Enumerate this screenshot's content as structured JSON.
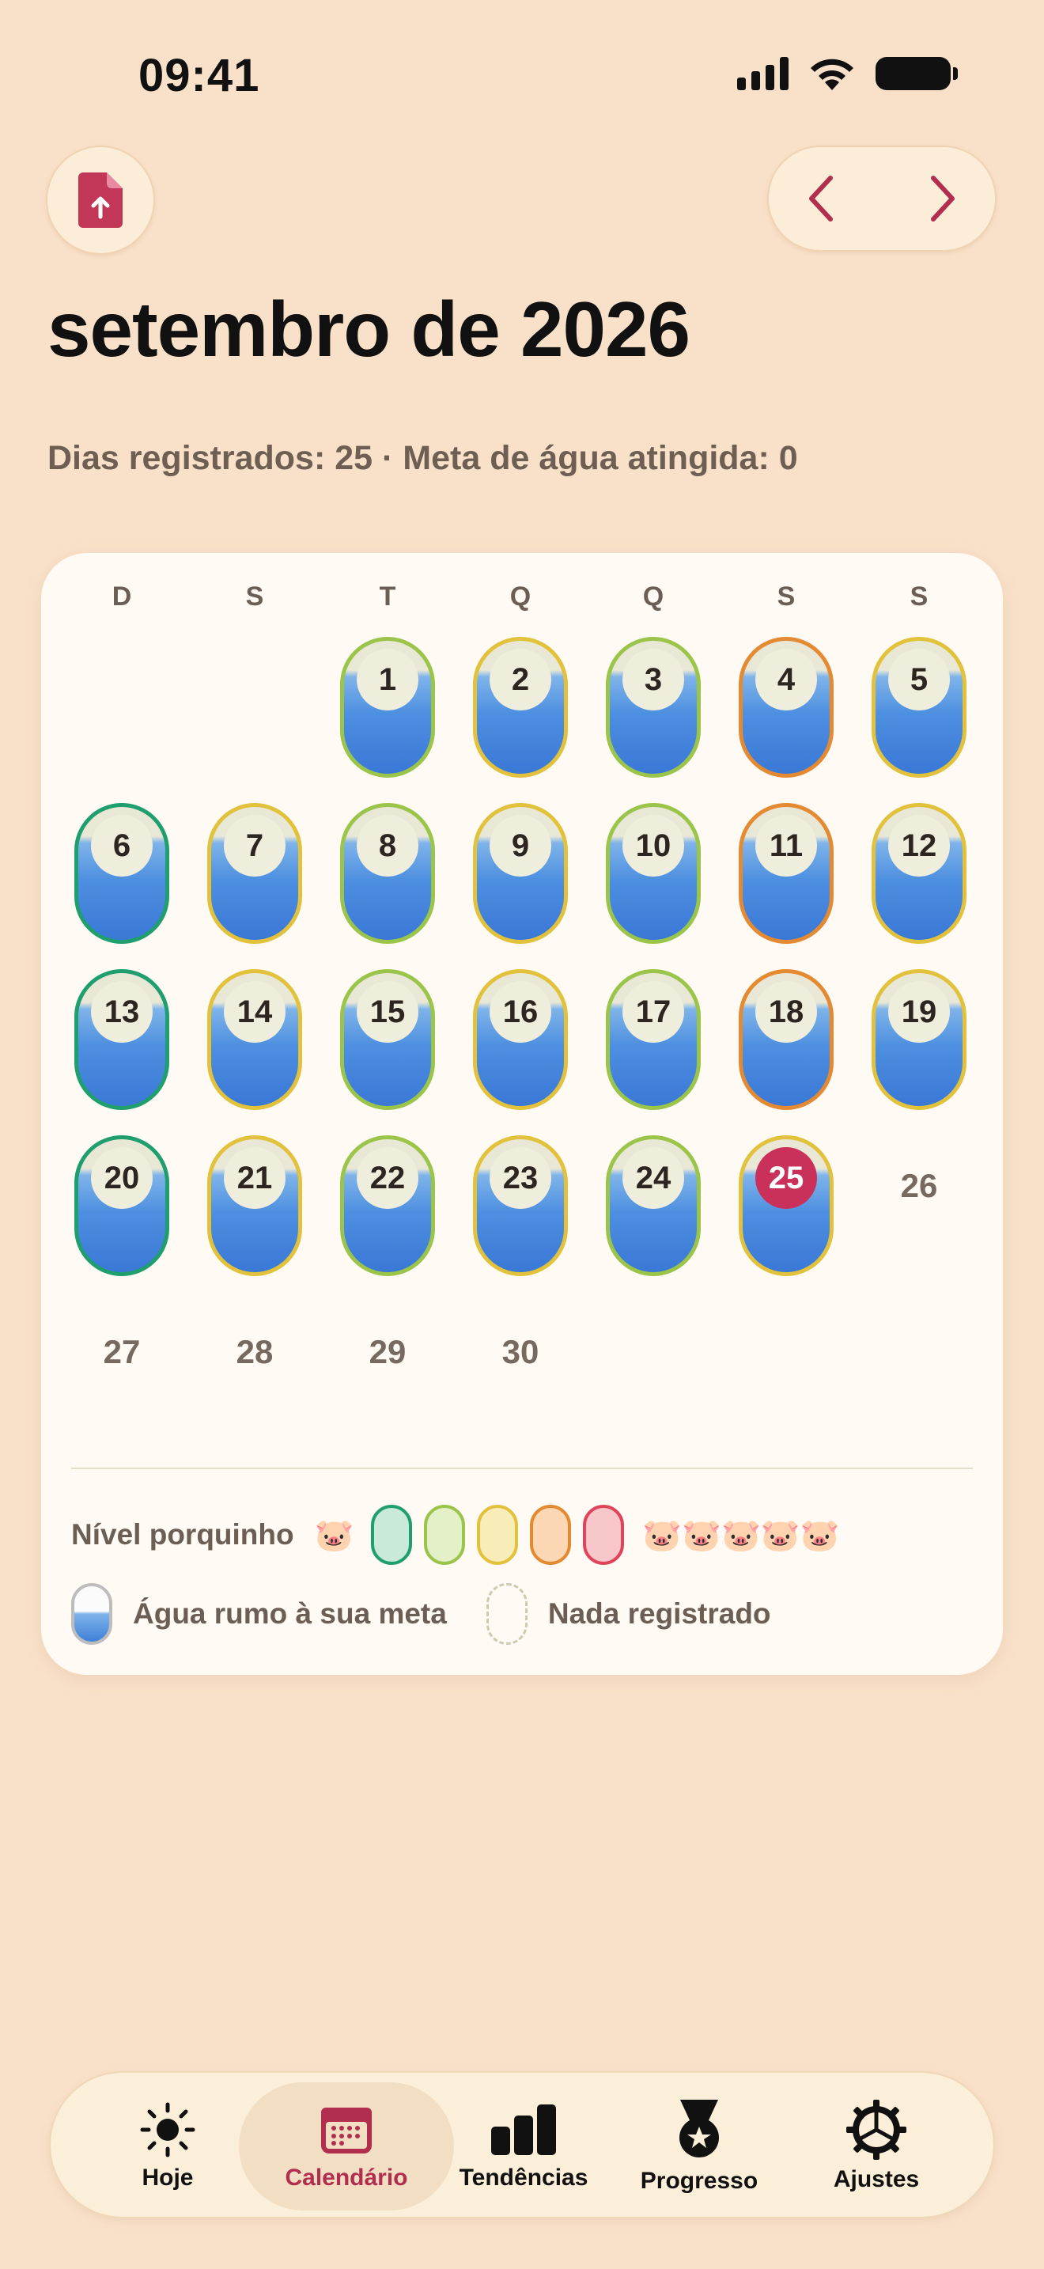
{
  "status_bar": {
    "time": "09:41"
  },
  "header": {
    "title": "setembro de 2026",
    "summary": "Dias registrados: 25 · Meta de água atingida: 0"
  },
  "calendar": {
    "weekdays": [
      "D",
      "S",
      "T",
      "Q",
      "Q",
      "S",
      "S"
    ],
    "days": [
      {
        "n": "1",
        "level": "light-green"
      },
      {
        "n": "2",
        "level": "yellow"
      },
      {
        "n": "3",
        "level": "light-green"
      },
      {
        "n": "4",
        "level": "orange"
      },
      {
        "n": "5",
        "level": "yellow"
      },
      {
        "n": "6",
        "level": "green"
      },
      {
        "n": "7",
        "level": "yellow"
      },
      {
        "n": "8",
        "level": "light-green"
      },
      {
        "n": "9",
        "level": "yellow"
      },
      {
        "n": "10",
        "level": "light-green"
      },
      {
        "n": "11",
        "level": "orange"
      },
      {
        "n": "12",
        "level": "yellow"
      },
      {
        "n": "13",
        "level": "green"
      },
      {
        "n": "14",
        "level": "yellow"
      },
      {
        "n": "15",
        "level": "light-green"
      },
      {
        "n": "16",
        "level": "yellow"
      },
      {
        "n": "17",
        "level": "light-green"
      },
      {
        "n": "18",
        "level": "orange"
      },
      {
        "n": "19",
        "level": "yellow"
      },
      {
        "n": "20",
        "level": "green"
      },
      {
        "n": "21",
        "level": "yellow"
      },
      {
        "n": "22",
        "level": "light-green"
      },
      {
        "n": "23",
        "level": "yellow"
      },
      {
        "n": "24",
        "level": "light-green"
      },
      {
        "n": "25",
        "level": "yellow",
        "today": true
      },
      {
        "n": "26",
        "level": "none"
      },
      {
        "n": "27",
        "level": "none"
      },
      {
        "n": "28",
        "level": "none"
      },
      {
        "n": "29",
        "level": "none"
      },
      {
        "n": "30",
        "level": "none"
      }
    ],
    "first_weekday_index": 2
  },
  "legend": {
    "pig_label": "Nível porquinho",
    "pig_low": "🐷",
    "pig_high": "🐷🐷🐷🐷🐷",
    "water_label": "Água rumo à sua meta",
    "empty_label": "Nada registrado"
  },
  "colors": {
    "green": "#1f9e6e",
    "light-green": "#9bc54a",
    "yellow": "#e2c23c",
    "orange": "#e38a33",
    "red": "#e0445a",
    "accent": "#b22e4e",
    "today": "#c9315a"
  },
  "tabs": [
    {
      "label": "Hoje",
      "icon": "sun-icon"
    },
    {
      "label": "Calendário",
      "icon": "calendar-icon",
      "active": true
    },
    {
      "label": "Tendências",
      "icon": "bar-chart-icon"
    },
    {
      "label": "Progresso",
      "icon": "medal-icon"
    },
    {
      "label": "Ajustes",
      "icon": "gear-icon"
    }
  ]
}
